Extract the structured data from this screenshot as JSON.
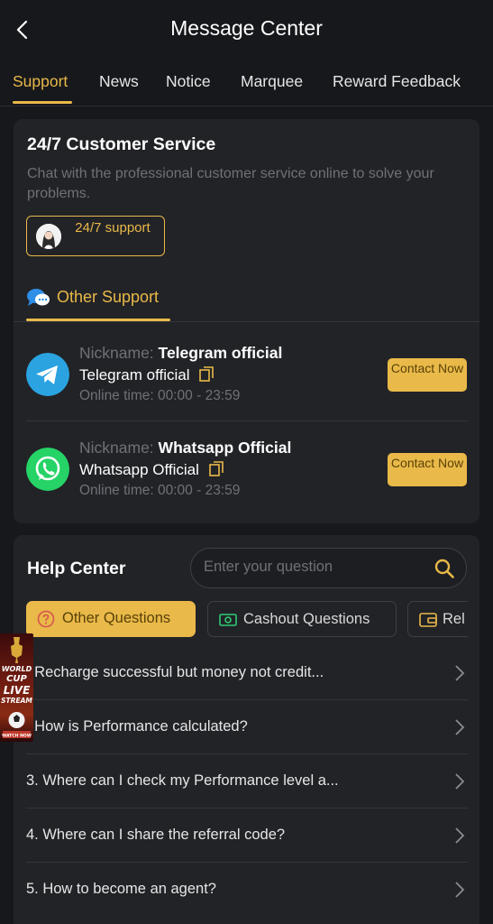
{
  "header": {
    "title": "Message Center",
    "back_icon": "chevron-left-icon"
  },
  "tabs": [
    {
      "label": "Support",
      "active": true
    },
    {
      "label": "News",
      "active": false
    },
    {
      "label": "Notice",
      "active": false
    },
    {
      "label": "Marquee",
      "active": false
    },
    {
      "label": "Reward Feedback",
      "active": false
    }
  ],
  "customer_service": {
    "title": "24/7 Customer Service",
    "description": "Chat with the professional customer service online to solve your problems.",
    "support_button_label": "24/7 support",
    "other_support_label": "Other Support",
    "contacts": [
      {
        "icon": "telegram-icon",
        "nickname_key": "Nickname:",
        "nickname": "Telegram official",
        "account": "Telegram official",
        "online_time": "Online time: 00:00 - 23:59",
        "button": "Contact Now"
      },
      {
        "icon": "whatsapp-icon",
        "nickname_key": "Nickname:",
        "nickname": "Whatsapp Official",
        "account": "Whatsapp Official",
        "online_time": "Online time: 00:00 - 23:59",
        "button": "Contact Now"
      }
    ]
  },
  "help_center": {
    "title": "Help Center",
    "search_placeholder": "Enter your question",
    "categories": [
      {
        "label": "Other Questions",
        "icon": "question-circle-icon",
        "active": true
      },
      {
        "label": "Cashout Questions",
        "icon": "cash-icon",
        "active": false
      },
      {
        "label": "Rel",
        "icon": "wallet-icon",
        "active": false
      }
    ],
    "questions": [
      ". Recharge successful but money not credit...",
      ". How is Performance calculated?",
      "3. Where can I check my Performance level a...",
      "4. Where can I share the referral code?",
      "5. How to become an agent?"
    ]
  },
  "ad_banner": {
    "lines": [
      "WORLD",
      "CUP",
      "LIVE",
      "STREAM",
      "WATCH NOW"
    ]
  },
  "colors": {
    "accent": "#e9b949",
    "background": "#17181c",
    "card": "#222327",
    "muted": "#6f7178"
  }
}
